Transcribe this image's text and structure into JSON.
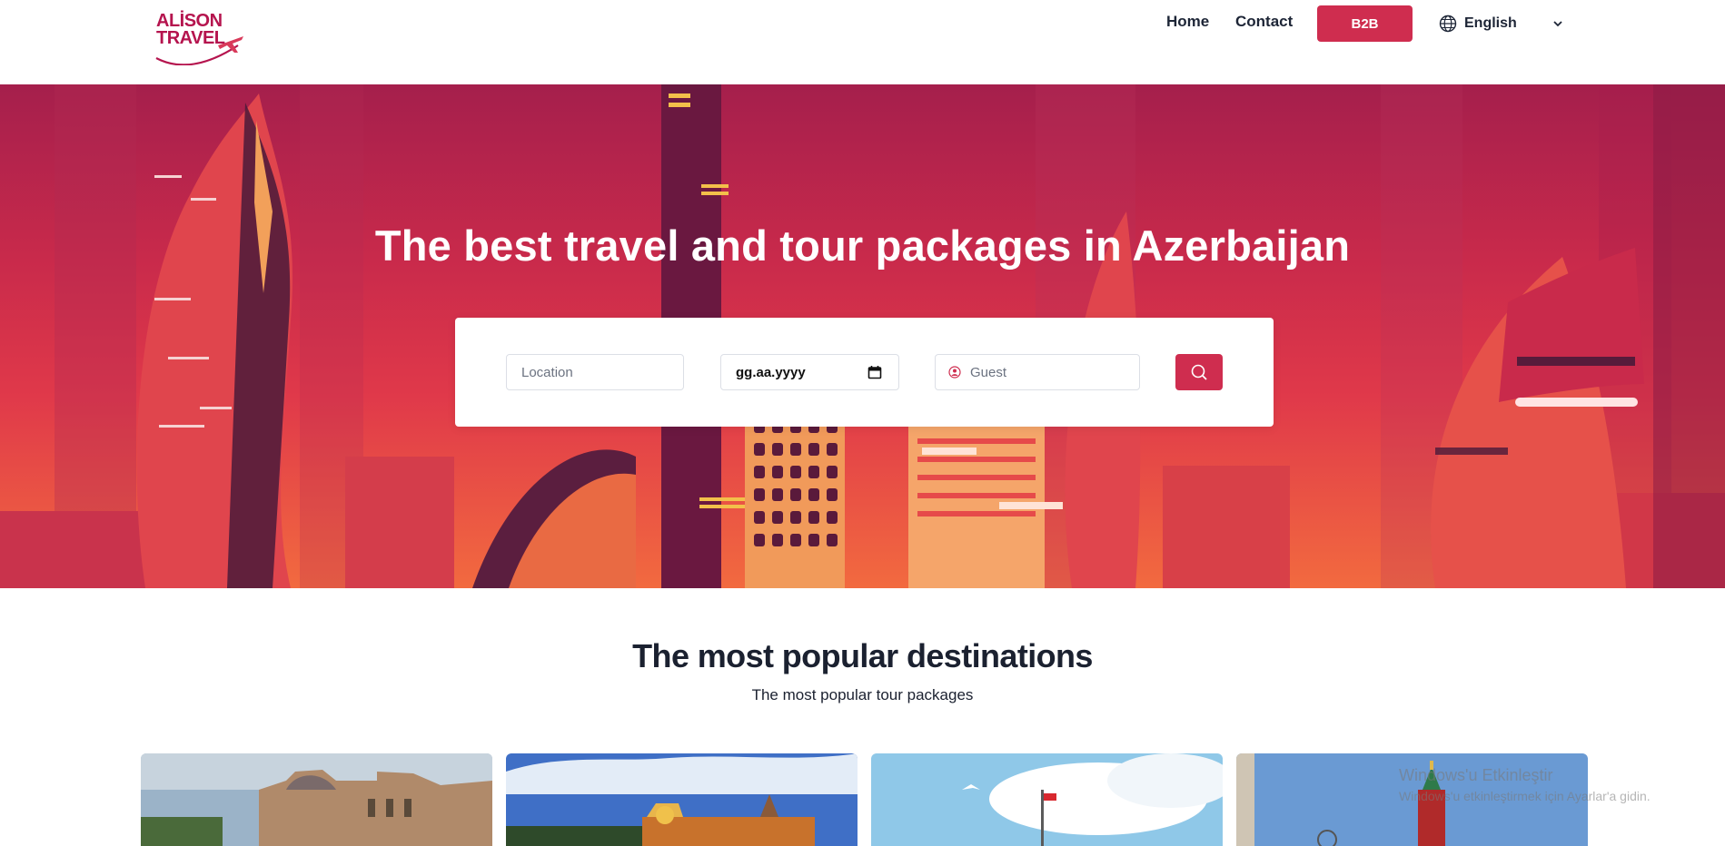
{
  "brand": {
    "line1": "ALİSON",
    "line2": "TRAVEL",
    "color": "#b5144e"
  },
  "nav": {
    "home": "Home",
    "contact": "Contact",
    "b2b": "B2B",
    "language": "English",
    "language_icon": "globe-icon"
  },
  "hero": {
    "title": "The best travel and tour packages in Azerbaijan"
  },
  "search": {
    "location_placeholder": "Location",
    "date_value": "gg.aa.yyyy",
    "guest_placeholder": "Guest",
    "button_icon": "search-icon"
  },
  "section": {
    "title": "The most popular destinations",
    "subtitle": "The most popular tour packages"
  },
  "watermark": {
    "line1": "Windows'u Etkinleştir",
    "line2": "Windows'u etkinleştirmek için Ayarlar'a gidin."
  },
  "colors": {
    "accent": "#cf2d4f",
    "text_dark": "#1b2130"
  }
}
